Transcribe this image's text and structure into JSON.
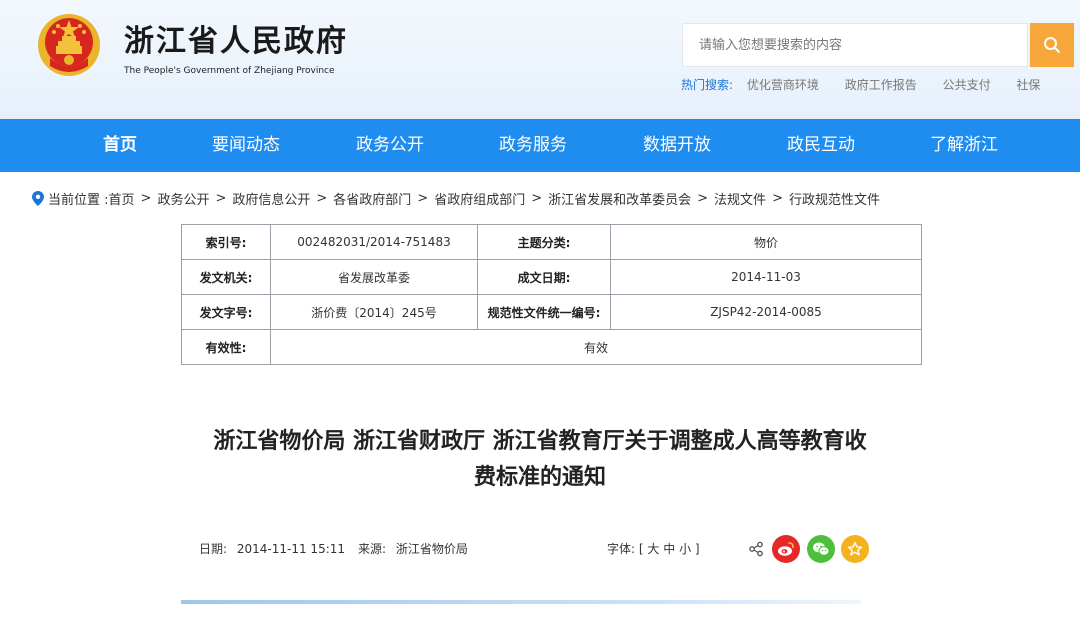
{
  "header": {
    "site_title": "浙江省人民政府",
    "site_subtitle": "The People's Government of Zhejiang Province",
    "search": {
      "placeholder": "请输入您想要搜索的内容"
    },
    "hot_label": "热门搜索:",
    "hot_links": [
      "优化营商环境",
      "政府工作报告",
      "公共支付",
      "社保"
    ]
  },
  "nav": {
    "items": [
      "首页",
      "要闻动态",
      "政务公开",
      "政务服务",
      "数据开放",
      "政民互动",
      "了解浙江"
    ],
    "active_index": 0
  },
  "breadcrumb": {
    "label": "当前位置 :",
    "items": [
      "首页",
      "政务公开",
      "政府信息公开",
      "各省政府部门",
      "省政府组成部门",
      "浙江省发展和改革委员会",
      "法规文件",
      "行政规范性文件"
    ]
  },
  "meta": {
    "index_label": "索引号:",
    "index_value": "002482031/2014-751483",
    "topic_label": "主题分类:",
    "topic_value": "物价",
    "issuer_label": "发文机关:",
    "issuer_value": "省发展改革委",
    "date_label": "成文日期:",
    "date_value": "2014-11-03",
    "docno_label": "发文字号:",
    "docno_value": "浙价费〔2014〕245号",
    "code_label": "规范性文件统一编号:",
    "code_value": "ZJSP42-2014-0085",
    "validity_label": "有效性:",
    "validity_value": "有效"
  },
  "article": {
    "title_line1": "浙江省物价局 浙江省财政厅 浙江省教育厅关于调整成人高等教育收",
    "title_line2": "费标准的通知",
    "date_label": "日期:",
    "date_value": "2014-11-11 15:11",
    "source_label": "来源:",
    "source_value": "浙江省物价局",
    "font_label": "字体:",
    "font_open": "[",
    "font_large": "大",
    "font_medium": "中",
    "font_small": "小",
    "font_close": "]"
  },
  "colors": {
    "nav_bg": "#1f8df0",
    "search_btn": "#f7a63a",
    "weibo": "#e6282b",
    "wechat": "#4cbf3b",
    "favorite": "#f5b21c"
  },
  "icons": [
    "emblem-icon",
    "search-icon",
    "location-pin-icon",
    "share-icon",
    "weibo-icon",
    "wechat-icon",
    "star-icon"
  ]
}
